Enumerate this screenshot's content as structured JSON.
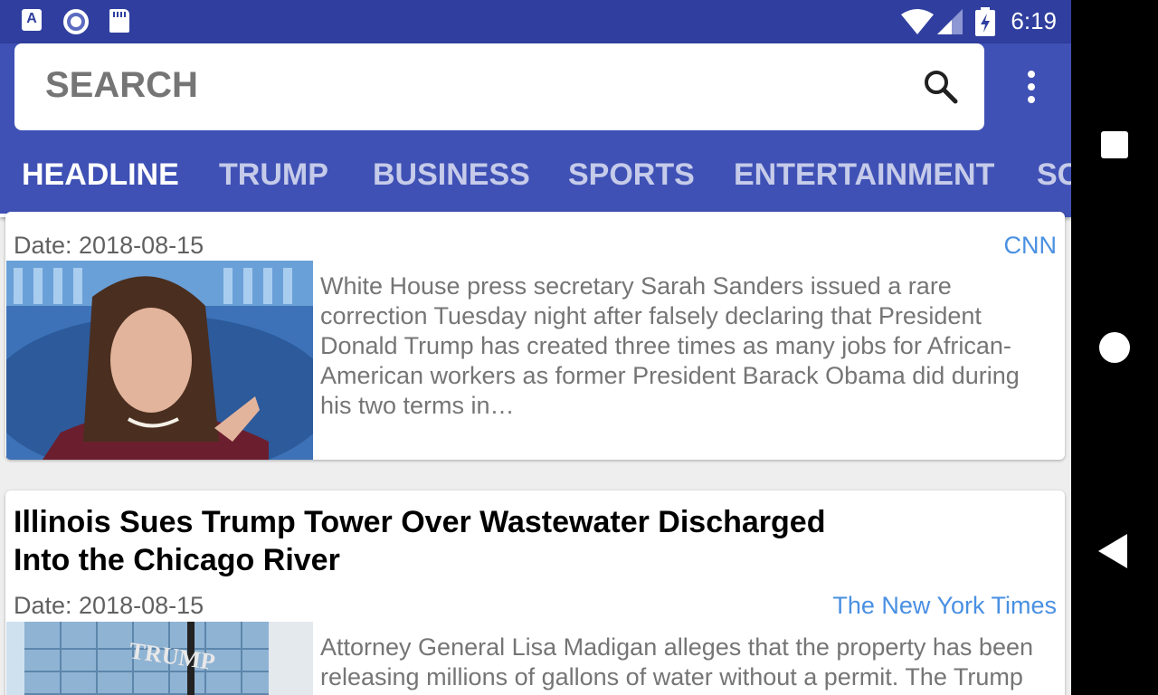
{
  "status_bar": {
    "time": "6:19",
    "left_icons": [
      "a-notification-icon",
      "circle-notification-icon",
      "sd-card-icon"
    ],
    "right_icons": [
      "wifi-icon",
      "cell-signal-icon",
      "battery-charging-icon"
    ]
  },
  "search": {
    "placeholder": "SEARCH"
  },
  "tabs": [
    {
      "label": "HEADLINE",
      "active": true
    },
    {
      "label": "TRUMP",
      "active": false
    },
    {
      "label": "BUSINESS",
      "active": false
    },
    {
      "label": "SPORTS",
      "active": false
    },
    {
      "label": "ENTERTAINMENT",
      "active": false
    },
    {
      "label": "SC",
      "active": false
    }
  ],
  "articles": [
    {
      "date": "Date: 2018-08-15",
      "source": "CNN",
      "description": "White House press secretary Sarah Sanders issued a rare correction Tuesday night after falsely declaring that President Donald Trump has created three times as many jobs for African-American workers as former President Barack Obama did during his two terms in…"
    },
    {
      "title": "Illinois Sues Trump Tower Over Wastewater Discharged Into the Chicago River",
      "date": "Date: 2018-08-15",
      "source": "The New York Times",
      "description": "Attorney General Lisa Madigan alleges that the property has been releasing millions of gallons of water without a permit. The Trump",
      "thumbnail_text": "TRUMP"
    }
  ],
  "colors": {
    "status_bar": "#303f9f",
    "app_bar": "#3f51b5",
    "source_link": "#4a90e2"
  }
}
